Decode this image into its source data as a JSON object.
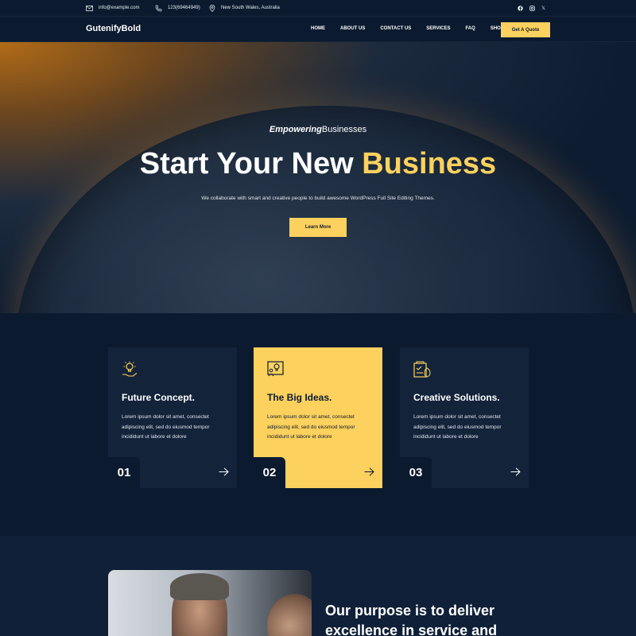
{
  "topbar": {
    "email": "info@example.com",
    "phone": "123(69464949)",
    "location": "New South Wales, Australia",
    "socials": [
      "facebook-icon",
      "instagram-icon",
      "x-icon"
    ],
    "x_label": "𝕏"
  },
  "nav": {
    "logo": "GutenifyBold",
    "items": [
      "HOME",
      "ABOUT US",
      "CONTACT US",
      "SERVICES",
      "FAQ",
      "SHOP"
    ],
    "cta": "Get A Quote"
  },
  "hero": {
    "eyebrow_em": "Empowering",
    "eyebrow_rest": "Businesses",
    "title_main": "Start Your New ",
    "title_accent": "Business",
    "subtitle": "We collaborate with smart and creative people to build awesome WordPress Full Site Editing Themes.",
    "button": "Learn More"
  },
  "features": [
    {
      "title": "Future Concept.",
      "text": "Lorem ipsum dolor sit amet, consectet adipiscing elit, sed do eiusmod tempor incididunt ut labore et dolore",
      "number": "01",
      "icon": "lightbulb-hand-icon"
    },
    {
      "title": "The Big Ideas.",
      "text": "Lorem ipsum dolor sit amet, consectet adipiscing elit, sed do eiusmod tempor incididunt ut labore et dolore",
      "number": "02",
      "icon": "idea-board-icon"
    },
    {
      "title": "Creative Solutions.",
      "text": "Lorem ipsum dolor sit amet, consectet adipiscing elit, sed do eiusmod tempor incididunt ut labore et dolore",
      "number": "03",
      "icon": "checklist-icon"
    }
  ],
  "purpose": {
    "heading": "Our purpose is to deliver excellence in service and"
  },
  "colors": {
    "accent": "#fdd15e",
    "background": "#0b1a2e",
    "card": "#13233a"
  }
}
